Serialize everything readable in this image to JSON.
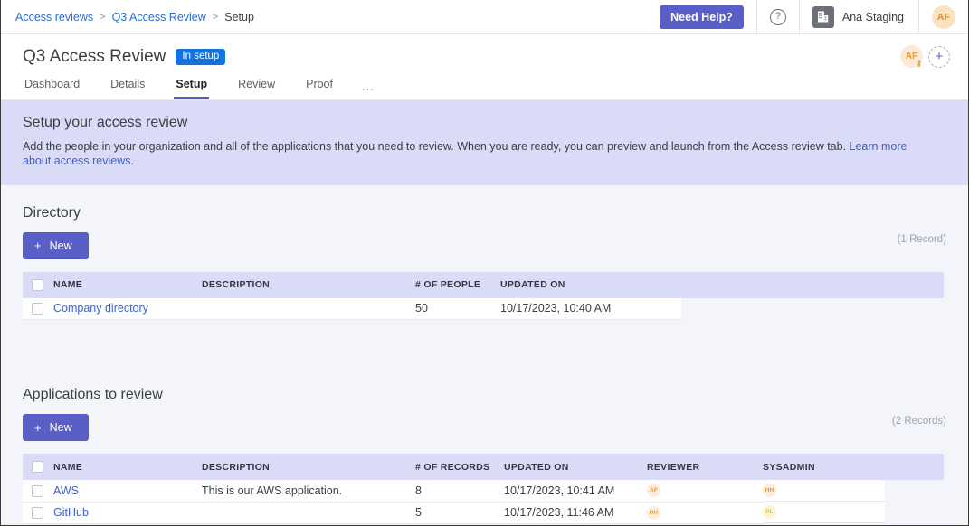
{
  "topbar": {
    "breadcrumb": [
      {
        "label": "Access reviews",
        "type": "link"
      },
      {
        "label": ">",
        "type": "sep"
      },
      {
        "label": "Q3 Access Review",
        "type": "link"
      },
      {
        "label": ">",
        "type": "sep"
      },
      {
        "label": "Setup",
        "type": "current"
      }
    ],
    "need_help_label": "Need Help?",
    "help_icon": "question-mark-circle-icon",
    "org_logo_icon": "building-icon",
    "org_name": "Ana Staging",
    "user_avatar_initials": "AF"
  },
  "header": {
    "title": "Q3 Access Review",
    "status_badge": "In setup",
    "owner_avatar_initials": "AF",
    "owner_key_icon": "key-icon",
    "add_person_icon": "plus-icon",
    "tabs": [
      {
        "label": "Dashboard",
        "active": false
      },
      {
        "label": "Details",
        "active": false
      },
      {
        "label": "Setup",
        "active": true
      },
      {
        "label": "Review",
        "active": false
      },
      {
        "label": "Proof",
        "active": false
      }
    ],
    "tabs_overflow": "..."
  },
  "banner": {
    "title": "Setup your access review",
    "text": "Add the people in your organization and all of the applications that you need to review. When you are ready, you can preview and launch from the Access review tab. ",
    "link_text": "Learn more about access reviews.",
    "bg_color": "#dadcf7"
  },
  "directory": {
    "title": "Directory",
    "new_label": "New",
    "record_count": "(1 Record)",
    "columns": [
      "NAME",
      "DESCRIPTION",
      "# OF PEOPLE",
      "UPDATED ON"
    ],
    "rows": [
      {
        "name": "Company directory",
        "description": "",
        "people": "50",
        "updated_on": "10/17/2023, 10:40 AM"
      }
    ]
  },
  "applications": {
    "title": "Applications to review",
    "new_label": "New",
    "record_count": "(2 Records)",
    "columns": [
      "NAME",
      "DESCRIPTION",
      "# OF RECORDS",
      "UPDATED ON",
      "REVIEWER",
      "SYSADMIN"
    ],
    "rows": [
      {
        "name": "AWS",
        "description": "This is our AWS application.",
        "records": "8",
        "updated_on": "10/17/2023, 10:41 AM",
        "reviewer": "AF",
        "reviewer_color": "orange",
        "sysadmin": "HH",
        "sysadmin_color": "orange"
      },
      {
        "name": "GitHub",
        "description": "",
        "records": "5",
        "updated_on": "10/17/2023, 11:46 AM",
        "reviewer": "HH",
        "reviewer_color": "orange",
        "sysadmin": "PL",
        "sysadmin_color": "yellow"
      }
    ]
  },
  "colors": {
    "accent": "#5a5fc7",
    "badge_blue": "#1273de",
    "link": "#4261c4",
    "page_bg": "#f4f5fa",
    "table_header": "#dadcf7"
  }
}
